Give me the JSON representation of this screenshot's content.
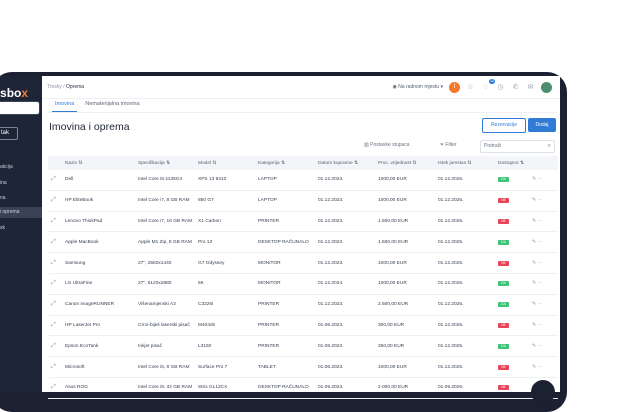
{
  "sidebar": {
    "logo_prefix": "s",
    "logo_main": "bo",
    "logo_x": "x",
    "button_label": "tak",
    "items": [
      {
        "label": "akcija"
      },
      {
        "label": "ina"
      },
      {
        "label": "na"
      },
      {
        "label": "i oprema"
      },
      {
        "label": "sk"
      }
    ]
  },
  "breadcrumb": {
    "root": "Trosky",
    "sep": "/",
    "current": "Oprema"
  },
  "topbar": {
    "user_text": "Na radnom mjestu",
    "avatar_letter": "I",
    "badge": "12"
  },
  "tabs": [
    {
      "label": "Imovina"
    },
    {
      "label": "Nematerijalna imovina"
    }
  ],
  "page": {
    "title": "Imovina i oprema"
  },
  "buttons": {
    "secondary": "Rezervacije",
    "primary": "Dodaj"
  },
  "controls": {
    "columns": "Postavke stupaca",
    "filter": "Filter",
    "search_placeholder": "Pretraži"
  },
  "table": {
    "headers": [
      "Naziv",
      "Specifikacija",
      "Model",
      "Kategorija",
      "Datum kupovine",
      "Proc. vrijednost",
      "Istek jamstva",
      "Dostupno"
    ],
    "rows": [
      {
        "name": "Dell",
        "spec": "Intel Core i5-1135G4",
        "model": "XPS 13 9310",
        "cat": "LAPTOP",
        "date": "01.12.2023.",
        "value": "1000,00 EUR",
        "warranty": "01.12.2025.",
        "status": "DA",
        "ok": true
      },
      {
        "name": "HP EliteBook",
        "spec": "Intel Core i7, 8 GB RAM",
        "model": "850 G7",
        "cat": "LAPTOP",
        "date": "01.12.2023.",
        "value": "1000,00 EUR",
        "warranty": "01.12.2025.",
        "status": "NE",
        "ok": false
      },
      {
        "name": "Lenovo ThinkPad",
        "spec": "Intel Core i7, 16 GB RAM",
        "model": "X1 Carbon",
        "cat": "PRINTER",
        "date": "01.12.2023.",
        "value": "1.500,00 EUR",
        "warranty": "01.12.2025.",
        "status": "NE",
        "ok": false
      },
      {
        "name": "Apple MacBook",
        "spec": "Apple M1 Zip, 8 GB RAM",
        "model": "Pro 13",
        "cat": "DESKTOP RAČUNALO",
        "date": "01.12.2023.",
        "value": "1.500,00 EUR",
        "warranty": "01.12.2025.",
        "status": "DA",
        "ok": true
      },
      {
        "name": "Samsung",
        "spec": "27\", 2560x1440",
        "model": "G7 Odyssey",
        "cat": "MONITOR",
        "date": "01.12.2023.",
        "value": "1000,00 EUR",
        "warranty": "01.12.2025.",
        "status": "NE",
        "ok": false
      },
      {
        "name": "LG UltraFine",
        "spec": "27\", 5120x2880",
        "model": "5K",
        "cat": "MONITOR",
        "date": "01.12.2024.",
        "value": "1000,00 EUR",
        "warranty": "01.12.2025.",
        "status": "DA",
        "ok": true
      },
      {
        "name": "Canon imageRUNNER",
        "spec": "Višenamjenski A3",
        "model": "C3226i",
        "cat": "PRINTER",
        "date": "01.12.2023.",
        "value": "2.500,00 EUR",
        "warranty": "01.12.2025.",
        "status": "DA",
        "ok": true
      },
      {
        "name": "HP LaserJet Pro",
        "spec": "Crno-bijeli laserski pisač",
        "model": "M404dn",
        "cat": "PRINTER",
        "date": "01.06.2023.",
        "value": "300,00 EUR",
        "warranty": "01.12.2025.",
        "status": "NE",
        "ok": false
      },
      {
        "name": "Epson EcoTank",
        "spec": "Inkjet pisač",
        "model": "L3150",
        "cat": "PRINTER",
        "date": "01.08.2023.",
        "value": "250,00 EUR",
        "warranty": "01.12.2025.",
        "status": "DA",
        "ok": true
      },
      {
        "name": "Microsoft",
        "spec": "Intel Core i5, 8 GB RAM",
        "model": "Surface Pro 7",
        "cat": "TABLET",
        "date": "01.06.2023.",
        "value": "1000,00 EUR",
        "warranty": "01.12.2025.",
        "status": "NE",
        "ok": false
      },
      {
        "name": "Asus ROG",
        "spec": "Intel Core i9, 32 GB RAM",
        "model": "Strix GL12CX",
        "cat": "DESKTOP RAČUNALO",
        "date": "01.09.2023.",
        "value": "2.000,00 EUR",
        "warranty": "01.09.2026.",
        "status": "NE",
        "ok": false
      }
    ]
  }
}
